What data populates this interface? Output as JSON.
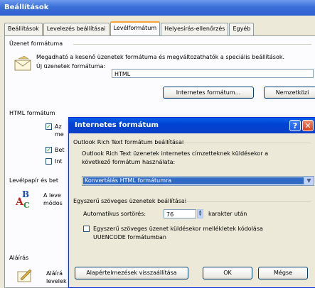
{
  "window": {
    "title": "Beállítások"
  },
  "tabs": [
    "Beállítások",
    "Levelezés beállításai",
    "Levélformátum",
    "Helyesírás-ellenőrzés",
    "Egyéb"
  ],
  "tabs_active_index": 2,
  "message_format": {
    "group_label": "Üzenet formátuma",
    "description": "Megadható a kesenő üzenetek formátuma és megváltozathatók a speciális beállítások.",
    "new_messages_label": "Új üzenetek formátuma:",
    "format_value": "HTML",
    "internet_format_button": "Internetes formátum...",
    "international_button": "Nemzetközi"
  },
  "html_format": {
    "group_label": "HTML formátum",
    "option1": "Az",
    "option1_line2": "me",
    "option2": "Bet",
    "option3": "Int",
    "checked": [
      true,
      true,
      false
    ]
  },
  "stationery": {
    "group_label": "Levélpapír és bet",
    "line1": "A leve",
    "line2": "módos"
  },
  "signature": {
    "group_label": "Aláírás",
    "line1": "Aláírá",
    "line2": "levelek"
  },
  "dialog": {
    "title": "Internetes formátum",
    "help_label": "?",
    "close_label": "✕",
    "rtf_group_label": "Outlook Rich Text formátum beállításai",
    "rtf_description_line1": "Outlook Rich Text üzenetek internetes címzetteknek küldésekor a",
    "rtf_description_line2": "következő formátum használata:",
    "rtf_select_value": "Konvertálás HTML formátumra",
    "plain_group_label": "Egyszerű szöveges üzenetek beállításai",
    "autowrap_label": "Automatikus sortörés:",
    "autowrap_value": "76",
    "autowrap_suffix": "karakter után",
    "uuencode_label_line1": "Egyszerű szöveges üzenet küldésekor mellékletek kódolása",
    "uuencode_label_line2": "UUENCODE formátumban",
    "uuencode_checked": false,
    "restore_button": "Alapértelmezések visszaállítása",
    "ok_button": "OK",
    "cancel_button": "Mégse"
  },
  "colors": {
    "title_bar": "#3a6fd8",
    "dialog_title_bar": "#0043d4",
    "selection": "#316ac5",
    "close_button": "#e04a2a",
    "tab_highlight": "#f5a43b"
  }
}
